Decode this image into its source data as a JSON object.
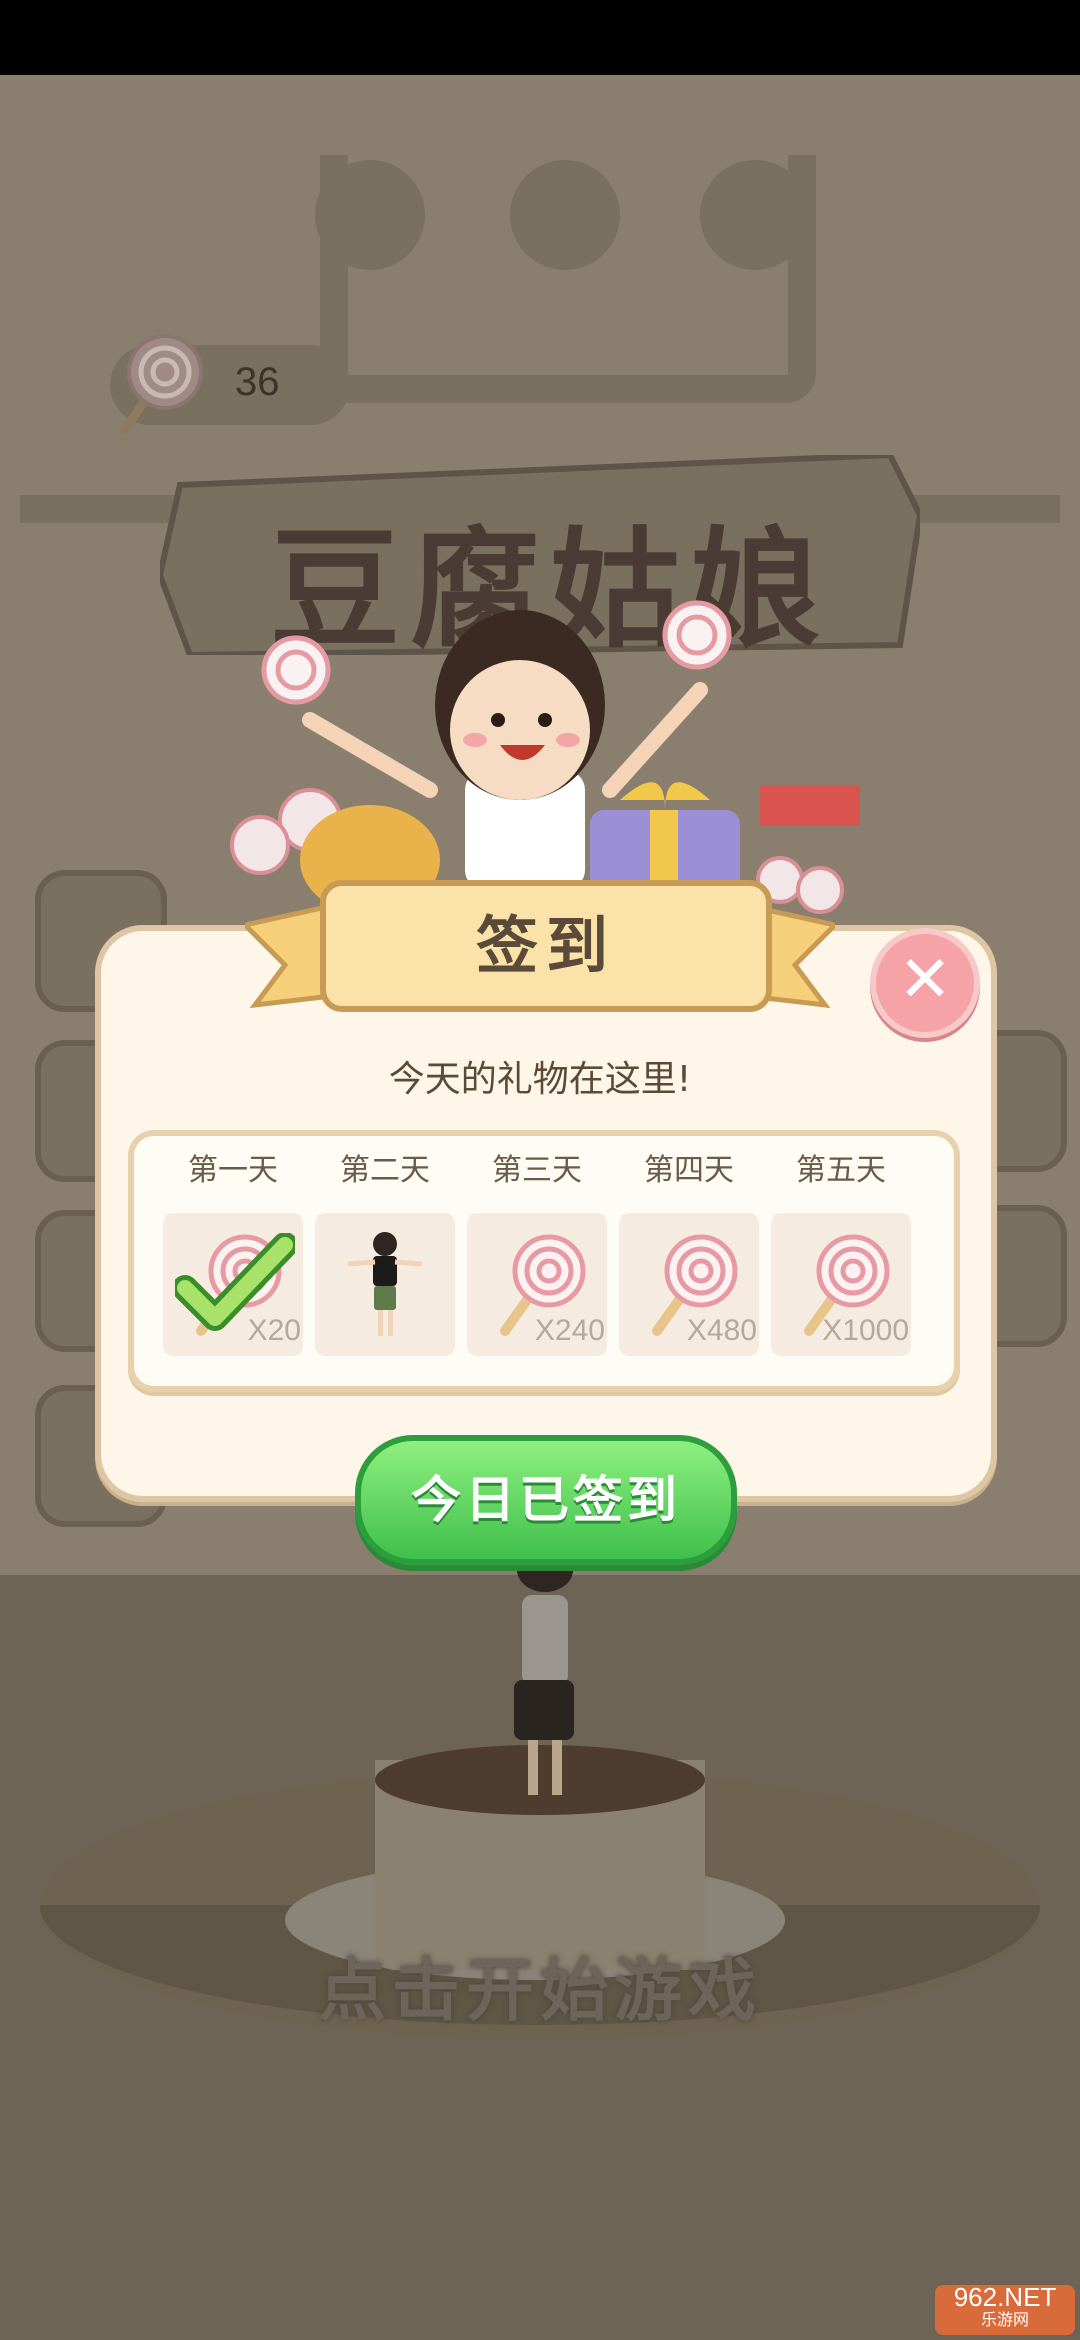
{
  "counter": {
    "value": "36"
  },
  "game_title": "豆腐姑娘",
  "dialog": {
    "title": "签到",
    "subtitle": "今天的礼物在这里!",
    "days": [
      {
        "label": "第一天",
        "reward": "X20",
        "claimed": true
      },
      {
        "label": "第二天",
        "reward": "",
        "claimed": false
      },
      {
        "label": "第三天",
        "reward": "X240",
        "claimed": false
      },
      {
        "label": "第四天",
        "reward": "X480",
        "claimed": false
      },
      {
        "label": "第五天",
        "reward": "X1000",
        "claimed": false
      }
    ],
    "button_label": "今日已签到"
  },
  "start_text": "点击开始游戏",
  "watermark": {
    "line1": "962.NET",
    "line2": "乐游网"
  },
  "colors": {
    "accent_green": "#3fbf4c",
    "dialog_bg": "#fdf6e9",
    "ribbon": "#fbe2a9",
    "close_pink": "#f6a3a8"
  }
}
